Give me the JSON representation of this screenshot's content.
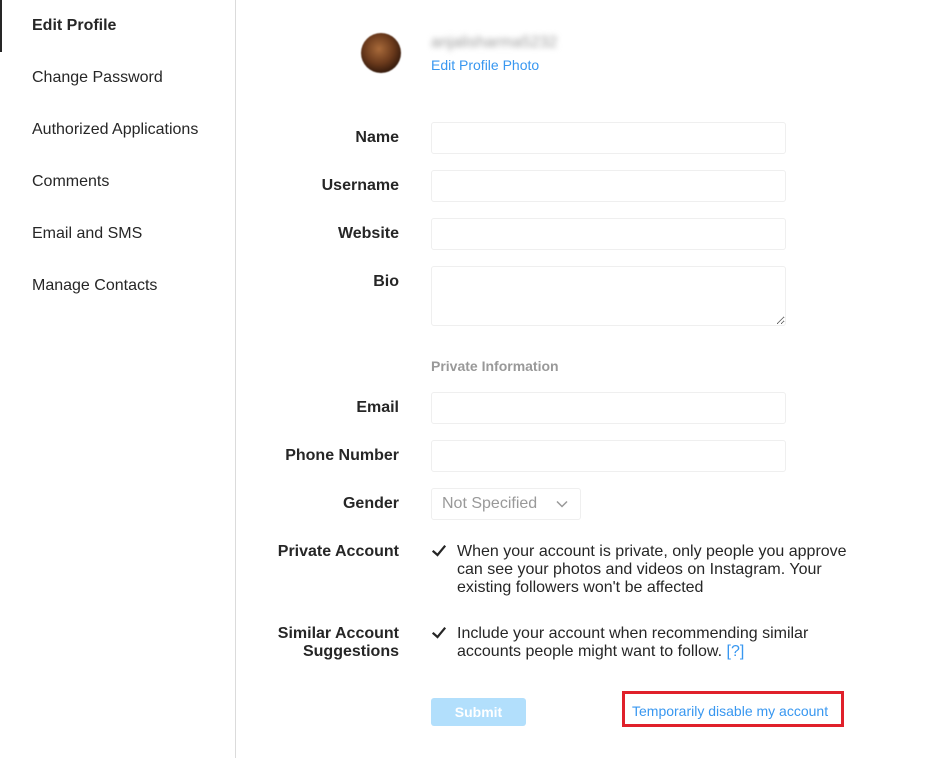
{
  "sidebar": {
    "items": [
      {
        "label": "Edit Profile",
        "active": true
      },
      {
        "label": "Change Password"
      },
      {
        "label": "Authorized Applications"
      },
      {
        "label": "Comments"
      },
      {
        "label": "Email and SMS"
      },
      {
        "label": "Manage Contacts"
      }
    ]
  },
  "profile": {
    "username_blurred": "anjalisharma5232",
    "edit_photo_label": "Edit Profile Photo"
  },
  "form": {
    "name_label": "Name",
    "name_value": "",
    "username_label": "Username",
    "username_value": "",
    "website_label": "Website",
    "website_value": "",
    "bio_label": "Bio",
    "bio_value": "",
    "private_info_heading": "Private Information",
    "email_label": "Email",
    "email_value": "",
    "phone_label": "Phone Number",
    "phone_value": "",
    "gender_label": "Gender",
    "gender_value": "Not Specified",
    "private_account_label": "Private Account",
    "private_account_checked": true,
    "private_account_text": "When your account is private, only people you approve can see your photos and videos on Instagram. Your existing followers won't be affected",
    "similar_label_line1": "Similar Account",
    "similar_label_line2": "Suggestions",
    "similar_checked": true,
    "similar_text": "Include your account when recommending similar accounts people might want to follow.",
    "similar_help": "[?]",
    "submit_label": "Submit",
    "disable_link": "Temporarily disable my account"
  },
  "colors": {
    "link": "#3897f0",
    "submit_bg": "#b2dffc",
    "highlight_box": "#e0202a"
  }
}
